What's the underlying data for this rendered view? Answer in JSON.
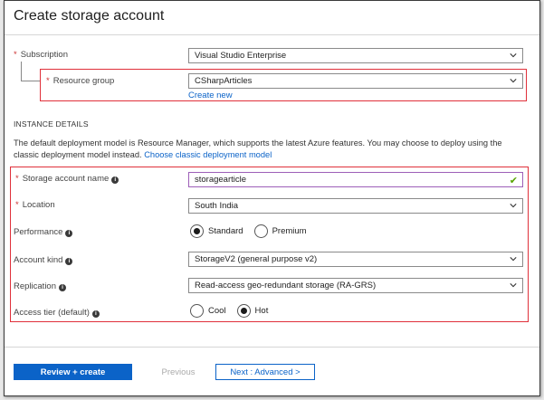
{
  "header": {
    "title": "Create storage account"
  },
  "subscription": {
    "label": "Subscription",
    "value": "Visual Studio Enterprise"
  },
  "resource_group": {
    "label": "Resource group",
    "value": "CSharpArticles",
    "create_new": "Create new"
  },
  "instance_details": {
    "heading": "INSTANCE DETAILS",
    "description": "The default deployment model is Resource Manager, which supports the latest Azure features. You may choose to deploy using the classic deployment model instead.",
    "classic_link": "Choose classic deployment model"
  },
  "storage_account_name": {
    "label": "Storage account name",
    "value": "storagearticle",
    "valid_mark": "✔"
  },
  "location": {
    "label": "Location",
    "value": "South India"
  },
  "performance": {
    "label": "Performance",
    "options": [
      "Standard",
      "Premium"
    ],
    "selected": "Standard"
  },
  "account_kind": {
    "label": "Account kind",
    "value": "StorageV2 (general purpose v2)"
  },
  "replication": {
    "label": "Replication",
    "value": "Read-access geo-redundant storage (RA-GRS)"
  },
  "access_tier": {
    "label": "Access tier (default)",
    "options": [
      "Cool",
      "Hot"
    ],
    "selected": "Hot"
  },
  "footer": {
    "review_create": "Review + create",
    "previous": "Previous",
    "next": "Next : Advanced >"
  },
  "required_mark": "*",
  "info_glyph": "i",
  "colors": {
    "accent": "#0b63c8",
    "highlight_border": "#e0303a",
    "required": "#c33",
    "valid": "#57a300"
  }
}
